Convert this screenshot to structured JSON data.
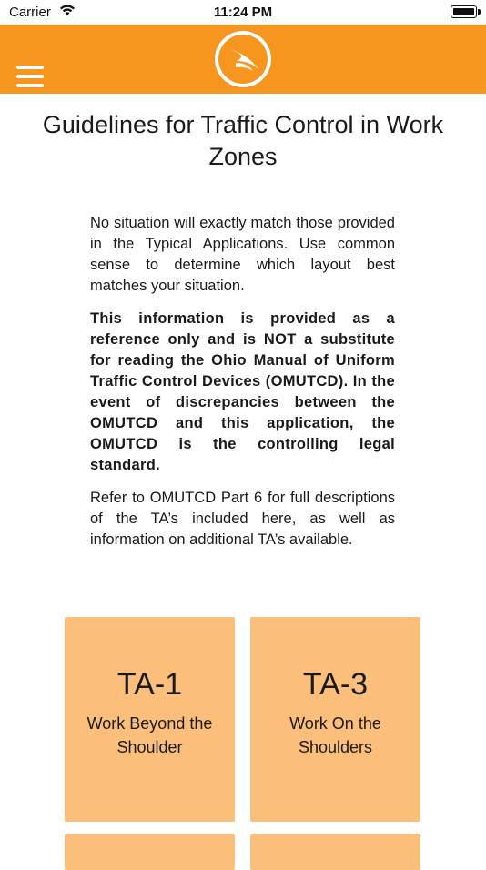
{
  "status_bar": {
    "carrier": "Carrier",
    "time": "11:24 PM"
  },
  "header": {
    "background_color": "#f6961e",
    "menu_icon": "hamburger-menu-icon",
    "logo": "odot-logo"
  },
  "page": {
    "title": "Guidelines for Traffic Control in Work Zones",
    "paragraphs": [
      "No situation will exactly match those provided in the Typical Applications. Use common sense to determine which layout best matches your situation.",
      "This information is provided as a reference only and is NOT a substitute for reading the Ohio Manual of Uniform Traffic Control Devices (OMUTCD). In the event of discrepancies between the OMUTCD and this application, the OMUTCD is the controlling legal standard.",
      "Refer to OMUTCD Part 6 for full descriptions of the TA’s included here, as well as information on additional TA’s available."
    ]
  },
  "tiles": [
    {
      "code": "TA-1",
      "description": "Work Beyond the Shoulder"
    },
    {
      "code": "TA-3",
      "description": "Work On the Shoulders"
    },
    {
      "code": "",
      "description": ""
    },
    {
      "code": "",
      "description": ""
    }
  ],
  "colors": {
    "tile_background": "#fbbf7b",
    "header_orange": "#f6961e"
  }
}
